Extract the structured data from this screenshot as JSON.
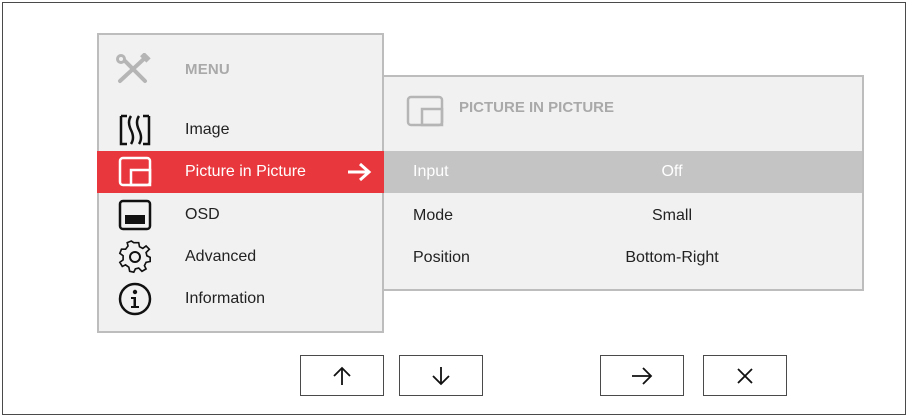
{
  "menu": {
    "title": "MENU",
    "title_icon": "tools-icon",
    "items": [
      {
        "label": "Image",
        "icon": "image-icon"
      },
      {
        "label": "Picture in Picture",
        "icon": "pip-icon",
        "selected": true
      },
      {
        "label": "OSD",
        "icon": "osd-icon"
      },
      {
        "label": "Advanced",
        "icon": "gear-icon"
      },
      {
        "label": "Information",
        "icon": "info-icon"
      }
    ],
    "selected_arrow_icon": "arrow-right-icon"
  },
  "submenu": {
    "title": "PICTURE IN PICTURE",
    "title_icon": "pip-icon",
    "rows": [
      {
        "name": "Input",
        "value": "Off",
        "selected": true
      },
      {
        "name": "Mode",
        "value": "Small"
      },
      {
        "name": "Position",
        "value": "Bottom-Right"
      }
    ]
  },
  "buttons": [
    {
      "icon": "arrow-up-icon"
    },
    {
      "icon": "arrow-down-icon"
    },
    {
      "icon": "arrow-right-icon"
    },
    {
      "icon": "close-icon"
    }
  ],
  "colors": {
    "accent": "#e8383e",
    "selected_row": "#c4c4c4",
    "panel": "#f1f1f1",
    "panel_border": "#bdbdbd"
  }
}
